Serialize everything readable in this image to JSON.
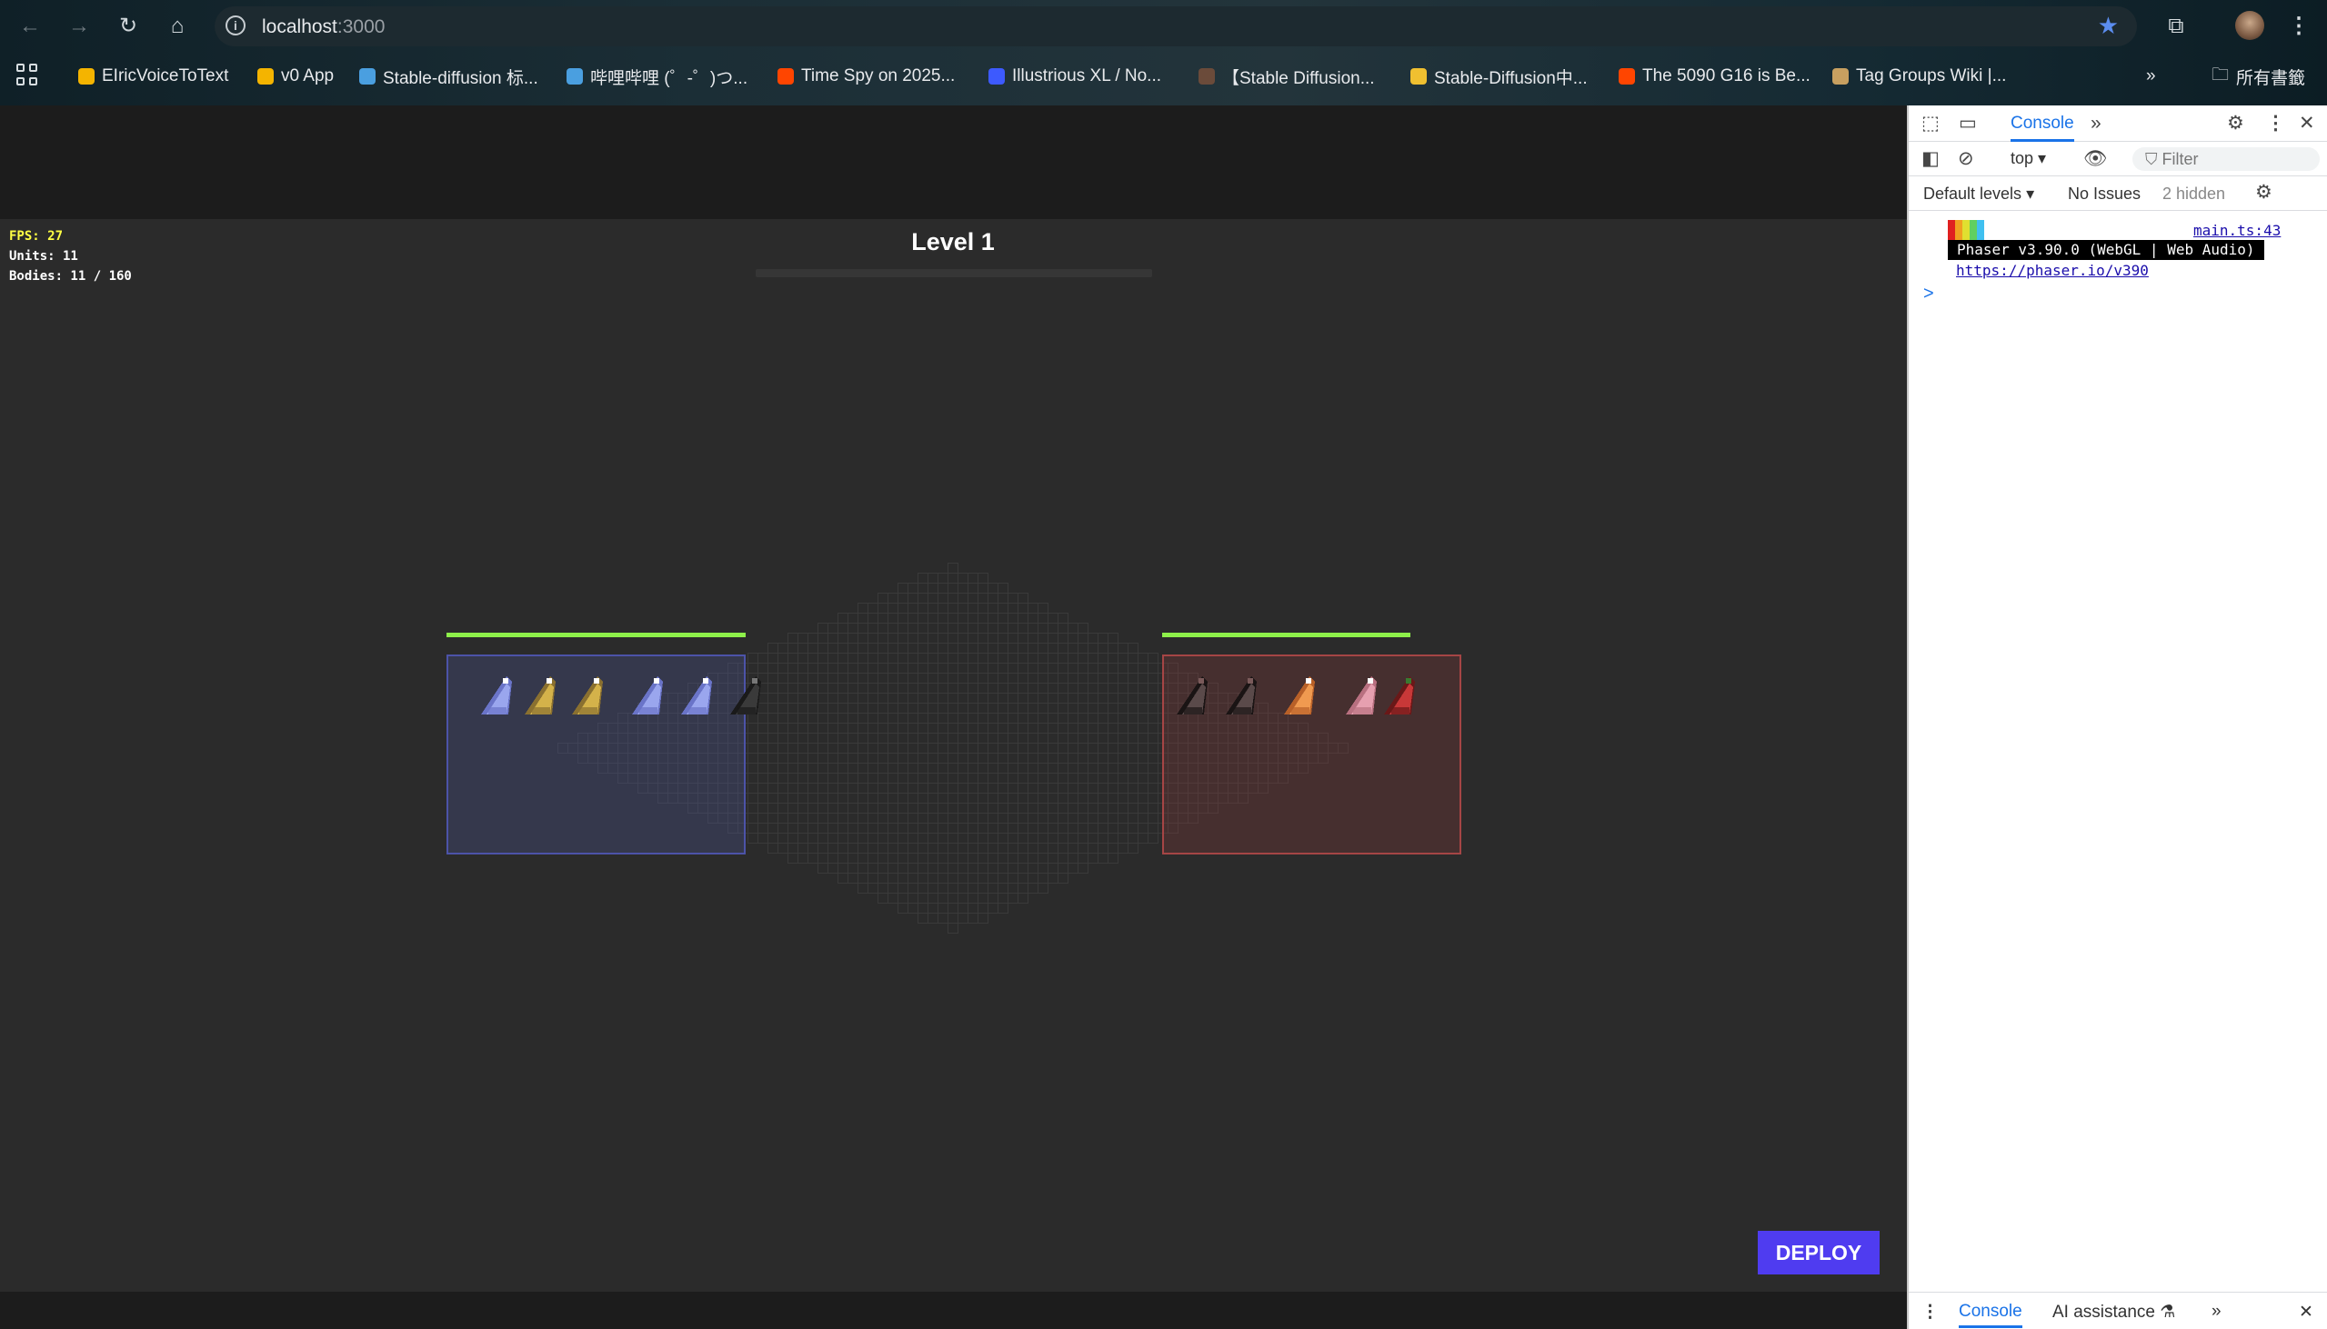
{
  "browser": {
    "url_host": "localhost",
    "url_port": ":3000",
    "bookmarks": [
      {
        "label": "EIricVoiceToText",
        "color": "#f4b400"
      },
      {
        "label": "v0 App",
        "color": "#f4b400"
      },
      {
        "label": "Stable-diffusion 标...",
        "color": "#4a9fe0"
      },
      {
        "label": "哔哩哔哩 (゜-゜)つ...",
        "color": "#4a9fe0"
      },
      {
        "label": "Time Spy on 2025...",
        "color": "#ff4500"
      },
      {
        "label": "Illustrious XL / No...",
        "color": "#3d5afe"
      },
      {
        "label": "【Stable Diffusion...",
        "color": "#6b4b3a"
      },
      {
        "label": "Stable-Diffusion中...",
        "color": "#f0c030"
      },
      {
        "label": "The 5090 G16 is Be...",
        "color": "#ff4500"
      },
      {
        "label": "Tag Groups Wiki |...",
        "color": "#c8a060"
      }
    ],
    "overflow": "»",
    "all_bookmarks": "所有書籤"
  },
  "game": {
    "fps": "FPS: 27",
    "units": "Units: 11",
    "bodies": "Bodies: 11 / 160",
    "level_title": "Level 1",
    "deploy_label": "DEPLOY",
    "player_hp_fraction": 1.0,
    "enemy_hp_fraction": 0.83,
    "player_units": [
      {
        "color": "#9aa6ee",
        "shade": "#6a74c8",
        "accent": "#ffffff"
      },
      {
        "color": "#d4b24a",
        "shade": "#8a7030",
        "accent": "#ffffff"
      },
      {
        "color": "#d4b24a",
        "shade": "#8a7030",
        "accent": "#ffffff"
      },
      {
        "color": "#9aa6ee",
        "shade": "#6a74c8",
        "accent": "#ffffff"
      },
      {
        "color": "#9aa6ee",
        "shade": "#6a74c8",
        "accent": "#ffffff"
      },
      {
        "color": "#3a3a3a",
        "shade": "#1a1a1a",
        "accent": "#777777"
      }
    ],
    "enemy_units": [
      {
        "color": "#5a4a4a",
        "shade": "#1a1414",
        "accent": "#7a5a5a"
      },
      {
        "color": "#5a4a4a",
        "shade": "#1a1414",
        "accent": "#7a5a5a"
      },
      {
        "color": "#f09a50",
        "shade": "#b86028",
        "accent": "#ffffff"
      },
      {
        "color": "#e6a0b0",
        "shade": "#b87080",
        "accent": "#ffffff"
      },
      {
        "color": "#c83838",
        "shade": "#6a1818",
        "accent": "#3a7a30"
      }
    ]
  },
  "devtools": {
    "tab_console": "Console",
    "context": "top",
    "filter_placeholder": "Filter",
    "levels": "Default levels",
    "issues": "No Issues",
    "hidden": "2 hidden",
    "log_source": "main.ts:43",
    "phaser_banner": "Phaser v3.90.0 (WebGL | Web Audio)",
    "phaser_link": "https://phaser.io/v390",
    "phaser_colors": [
      "#e02020",
      "#f0a020",
      "#e0e030",
      "#60d060",
      "#40c0f0"
    ],
    "prompt": ">",
    "drawer_console": "Console",
    "drawer_ai": "AI assistance"
  }
}
